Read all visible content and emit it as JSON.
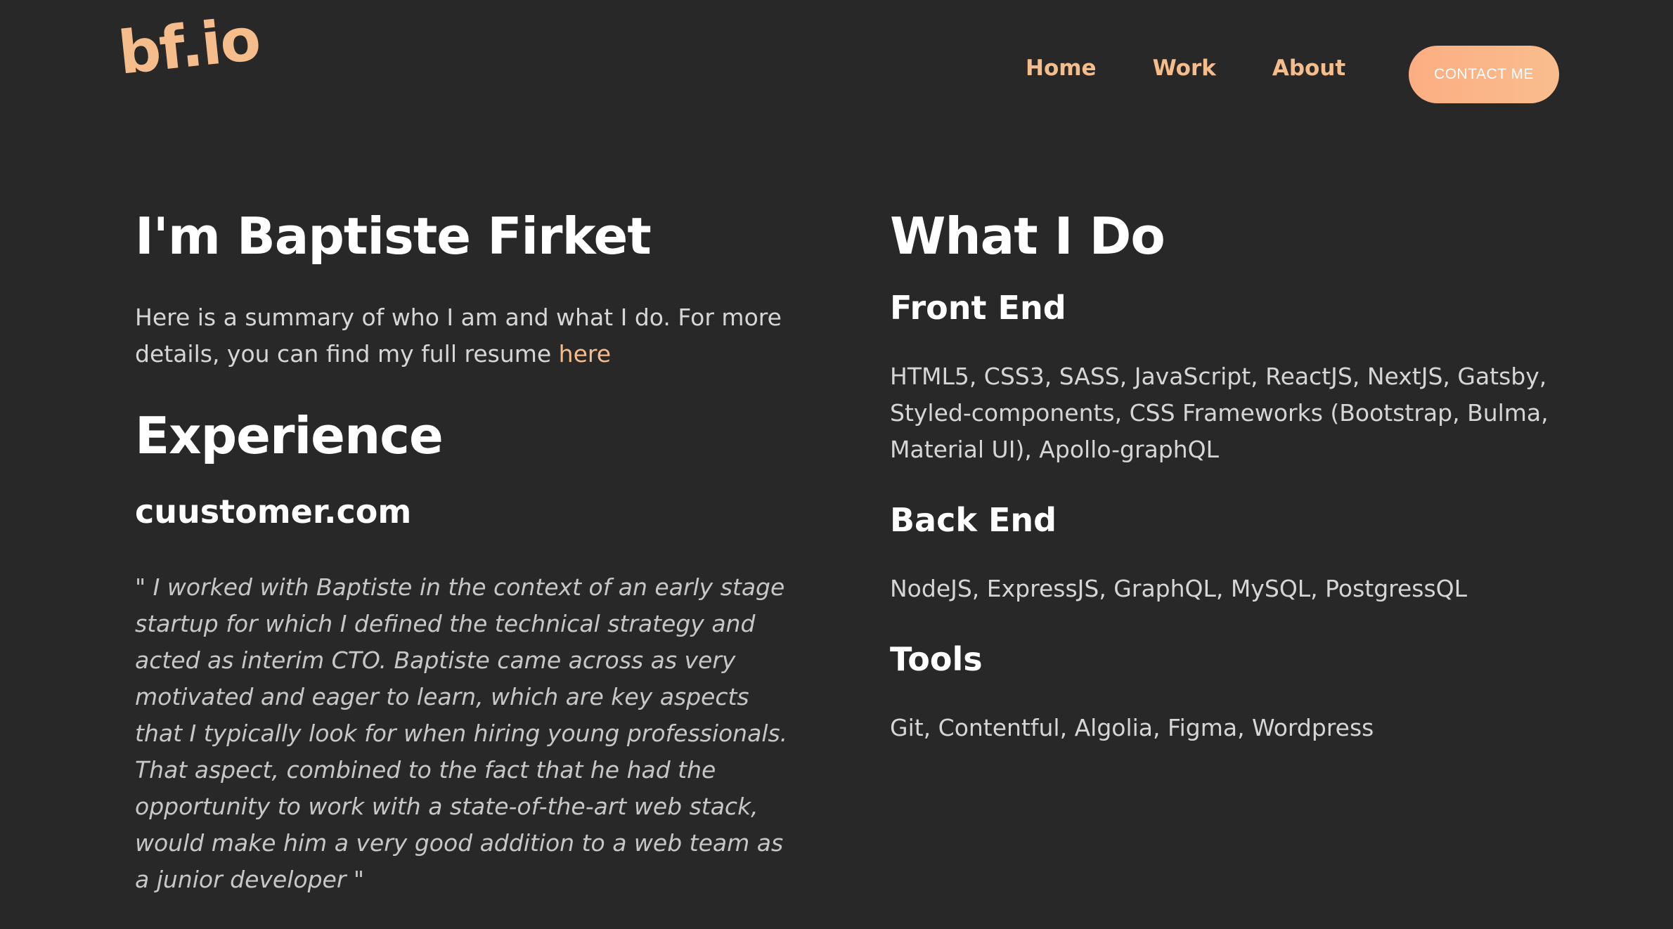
{
  "header": {
    "logo": "bf.io",
    "nav": [
      "Home",
      "Work",
      "About"
    ],
    "contact_label": "CONTACT ME"
  },
  "about": {
    "title": "I'm Baptiste Firket",
    "summary_text": "Here is a summary of who I am and what I do. For more details, you can find my full resume ",
    "summary_link": "here"
  },
  "experience": {
    "title": "Experience",
    "company": "cuustomer.com",
    "quote": "\" I worked with Baptiste in the context of an early stage startup for which I defined the technical strategy and acted as interim CTO. Baptiste came across as very motivated and eager to learn, which are key aspects that I typically look for when hiring young professionals. That aspect, combined to the fact that he had the opportunity to work with a state-of-the-art web stack, would make him a very good addition to a web team as a junior developer \""
  },
  "skills": {
    "title": "What I Do",
    "front_end_title": "Front End",
    "front_end": "HTML5, CSS3, SASS, JavaScript, ReactJS, NextJS, Gatsby, Styled-components, CSS Frameworks (Bootstrap, Bulma, Material UI), Apollo-graphQL",
    "back_end_title": "Back End",
    "back_end": "NodeJS, ExpressJS, GraphQL, MySQL, PostgressQL",
    "tools_title": "Tools",
    "tools": "Git, Contentful, Algolia, Figma, Wordpress"
  },
  "colors": {
    "background": "#282828",
    "accent": "#f5bd8c",
    "button_gradient_start": "#fcae83",
    "button_gradient_end": "#f9bd8d"
  }
}
